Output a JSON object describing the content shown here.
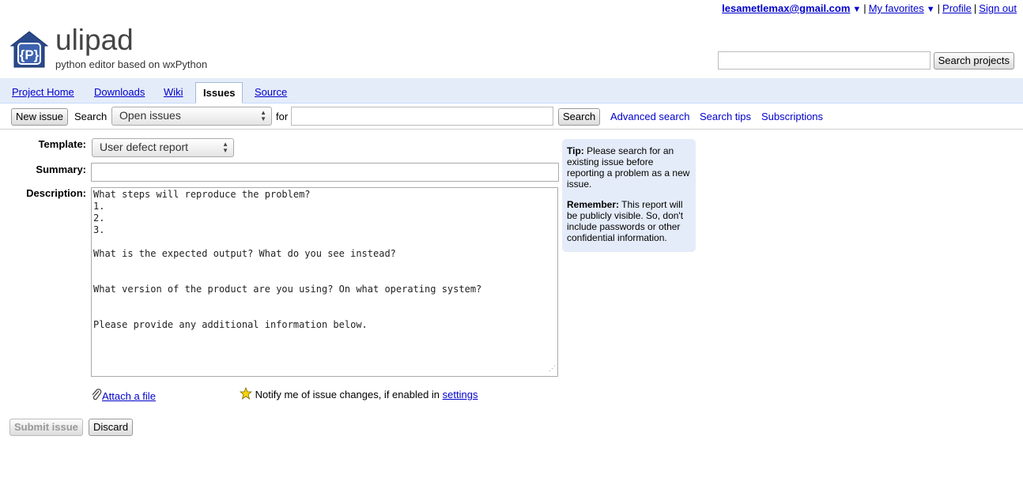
{
  "account": {
    "email": "lesametlemax@gmail.com",
    "favorites": "My favorites",
    "profile": "Profile",
    "sign_out": "Sign out",
    "arrow": "▼",
    "separator": "|"
  },
  "project": {
    "name": "ulipad",
    "summary": "python editor based on wxPython",
    "logo_letter": "{P}",
    "search_button": "Search projects",
    "search_value": ""
  },
  "tabs": [
    {
      "label": "Project Home",
      "active": false
    },
    {
      "label": "Downloads",
      "active": false
    },
    {
      "label": "Wiki",
      "active": false
    },
    {
      "label": "Issues",
      "active": true
    },
    {
      "label": "Source",
      "active": false
    }
  ],
  "issuebar": {
    "new_issue": "New issue",
    "search_label": "Search",
    "scope_selected": "Open issues",
    "for_label": "for",
    "for_value": "",
    "search_button": "Search",
    "advanced_search": "Advanced search",
    "search_tips": "Search tips",
    "subscriptions": "Subscriptions"
  },
  "form": {
    "template_label": "Template:",
    "template_selected": "User defect report",
    "summary_label": "Summary:",
    "summary_value": "",
    "description_label": "Description:",
    "description_value": "What steps will reproduce the problem?\n1.\n2.\n3.\n\nWhat is the expected output? What do you see instead?\n\n\nWhat version of the product are you using? On what operating system?\n\n\nPlease provide any additional information below.",
    "attach_link": "Attach a file",
    "notify_text": "Notify me of issue changes, if enabled in",
    "settings_link": "settings",
    "submit_button": "Submit issue",
    "discard_button": "Discard"
  },
  "tip": {
    "tip_heading": "Tip:",
    "tip_text": "Please search for an existing issue before reporting a problem as a new issue.",
    "remember_heading": "Remember:",
    "remember_text": "This report will be publicly visible. So, don't include passwords or other confidential information."
  },
  "colors": {
    "link": "#0000cc",
    "tab_strip": "#e5ecf9",
    "tip_bg": "#e5ecf9",
    "logo_blue": "#2a4a8c",
    "star": "#f5d60a"
  }
}
